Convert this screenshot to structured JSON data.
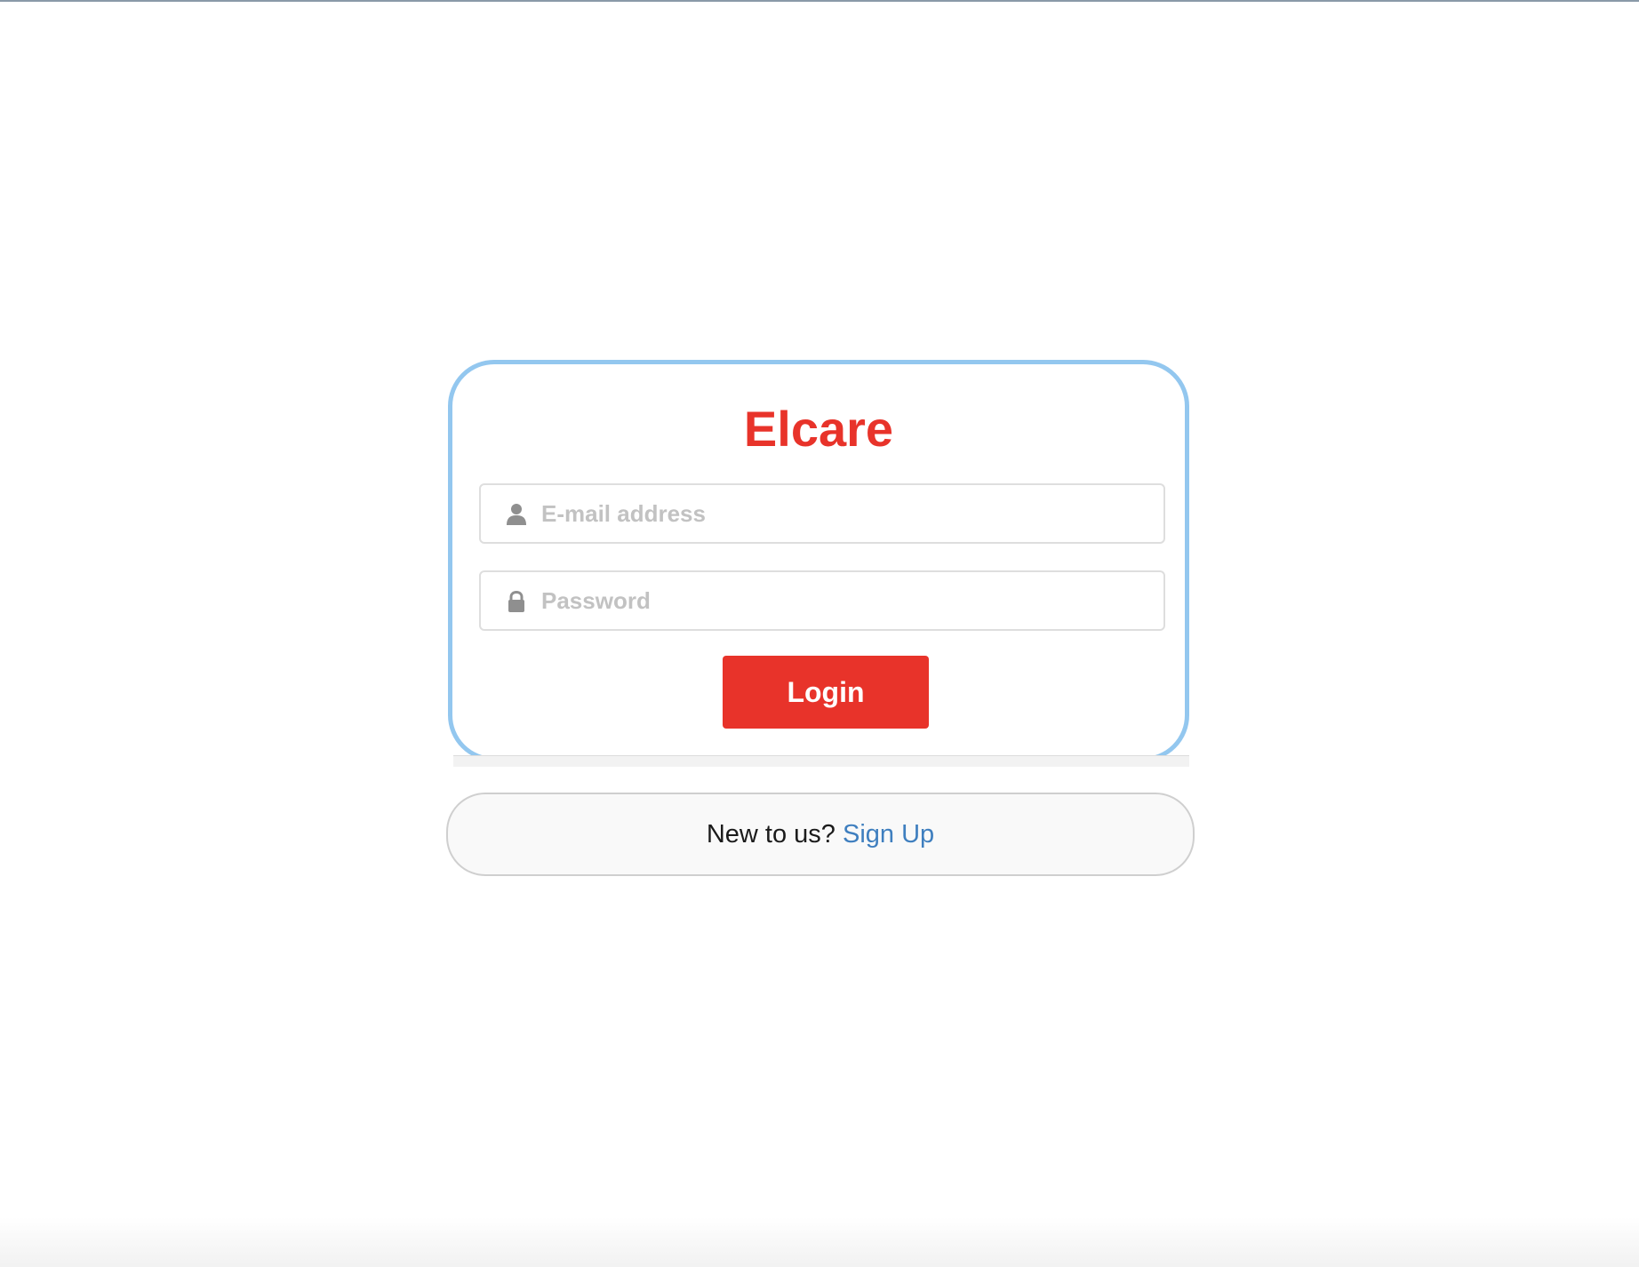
{
  "brand": {
    "title": "Elcare",
    "color": "#e8332a"
  },
  "form": {
    "email": {
      "placeholder": "E-mail address",
      "value": "",
      "icon": "user-icon"
    },
    "password": {
      "placeholder": "Password",
      "value": "",
      "icon": "lock-icon"
    },
    "login_label": "Login"
  },
  "signup": {
    "prompt": "New to us?",
    "link_label": "Sign Up",
    "link_color": "#3f7fbf"
  },
  "colors": {
    "card_border": "#93c7ef",
    "button_bg": "#e8332a"
  }
}
